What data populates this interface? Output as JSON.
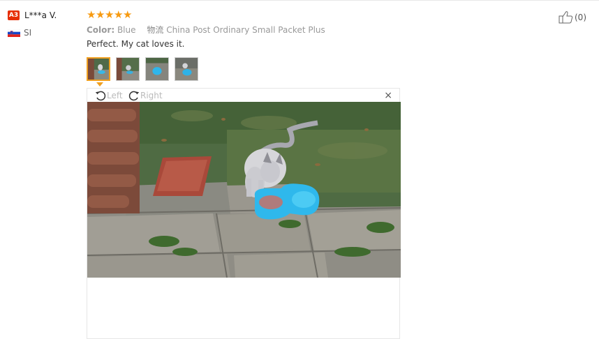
{
  "user": {
    "avatar_label": "A3",
    "name": "L***a V.",
    "country_code": "SI",
    "flag_icon": "slovenia-flag-icon"
  },
  "review": {
    "rating": 5,
    "rating_max": 5,
    "star_color": "#f79a10",
    "color_label": "Color:",
    "color_value": "Blue",
    "shipping_label": "物流",
    "shipping_value": "China Post Ordinary Small Packet Plus",
    "text": "Perfect. My cat loves it."
  },
  "thumbnails": [
    {
      "name": "review-photo-thumb-1",
      "active": true
    },
    {
      "name": "review-photo-thumb-2",
      "active": false
    },
    {
      "name": "review-photo-thumb-3",
      "active": false
    },
    {
      "name": "review-photo-thumb-4",
      "active": false
    }
  ],
  "viewer": {
    "rotate_left_label": "Left",
    "rotate_right_label": "Right",
    "close_symbol": "×",
    "photo_description_icon": "cat-eating-photo"
  },
  "helpful": {
    "count_text": "(0)",
    "icon": "thumbs-up-icon"
  }
}
